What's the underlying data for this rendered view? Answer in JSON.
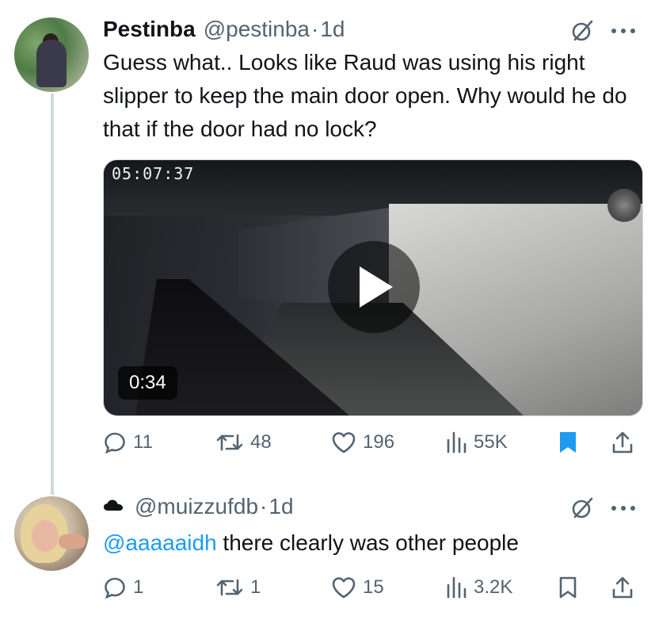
{
  "tweet": {
    "author_name": "Pestinba",
    "author_handle": "@pestinba",
    "separator": "·",
    "time": "1d",
    "text": "Guess what.. Looks like Raud was using his right slipper to keep the main door open. Why would he do that if the door had no lock?",
    "video": {
      "overlay_timestamp": "05:07:37",
      "duration": "0:34"
    },
    "actions": {
      "replies": "11",
      "reposts": "48",
      "likes": "196",
      "views": "55K",
      "bookmarked": true
    }
  },
  "reply": {
    "author_handle": "@muizzufdb",
    "separator": "·",
    "time": "1d",
    "mention": "@aaaaaidh",
    "text": " there clearly was other people",
    "actions": {
      "replies": "1",
      "reposts": "1",
      "likes": "15",
      "views": "3.2K",
      "bookmarked": false
    }
  },
  "colors": {
    "accent": "#1d9bf0",
    "secondary_text": "#536471",
    "thread_line": "#cfd9de"
  }
}
